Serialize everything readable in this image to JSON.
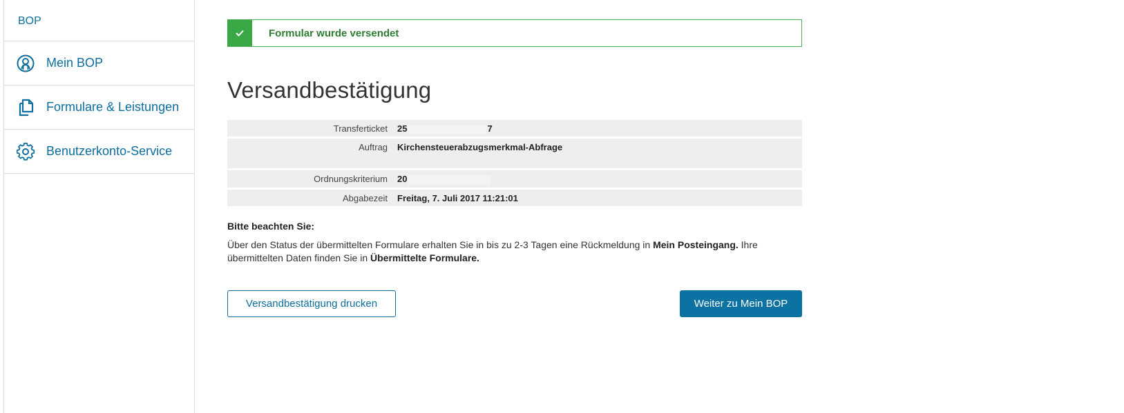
{
  "sidebar": {
    "brand": "BOP",
    "items": [
      {
        "label": "Mein BOP",
        "icon": "user-circle-icon"
      },
      {
        "label": "Formulare & Leistungen",
        "icon": "documents-icon"
      },
      {
        "label": "Benutzerkonto-Service",
        "icon": "gear-icon"
      }
    ]
  },
  "alert": {
    "text": "Formular wurde versendet",
    "icon": "checkmark-icon",
    "color": "#3aa845"
  },
  "main": {
    "title": "Versandbestätigung",
    "details": {
      "transferticket": {
        "label": "Transferticket",
        "value_start": "25",
        "value_end": "7"
      },
      "auftrag": {
        "label": "Auftrag",
        "value": "Kirchensteuerabzugsmerkmal-Abfrage"
      },
      "ordnungskriterium": {
        "label": "Ordnungskriterium",
        "value": "20"
      },
      "abgabezeit": {
        "label": "Abgabezeit",
        "value": "Freitag, 7. Juli 2017 11:21:01"
      }
    },
    "notice": {
      "heading": "Bitte beachten Sie:",
      "text_1": "Über den Status der übermittelten Formulare erhalten Sie in bis zu 2-3 Tagen eine Rückmeldung in ",
      "bold_1": "Mein Posteingang.",
      "text_2": " Ihre übermittelten Daten finden Sie in ",
      "bold_2": "Übermittelte Formulare."
    },
    "buttons": {
      "print": "Versandbestätigung drucken",
      "continue": "Weiter zu Mein BOP"
    }
  },
  "colors": {
    "accent": "#0b6e9e",
    "success": "#3aa845",
    "row_bg": "#eeeeee"
  }
}
